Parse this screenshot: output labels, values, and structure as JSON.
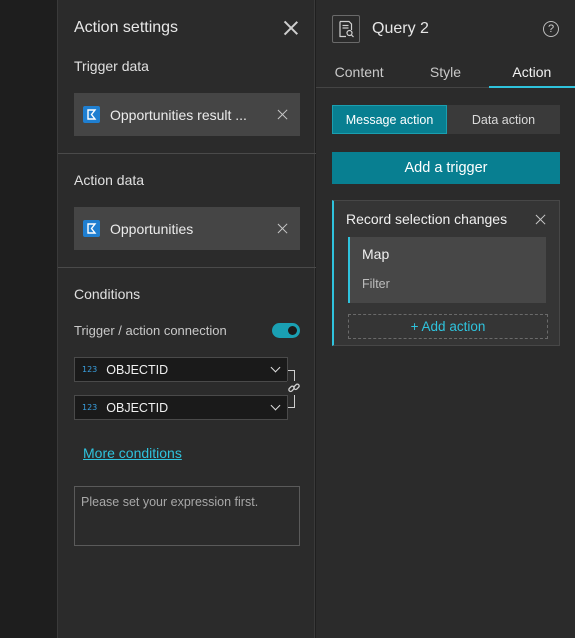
{
  "action_settings": {
    "title": "Action settings",
    "trigger_data_label": "Trigger data",
    "trigger_data_value": "Opportunities result ...",
    "action_data_label": "Action data",
    "action_data_value": "Opportunities",
    "conditions_label": "Conditions",
    "connection_label": "Trigger / action connection",
    "connection_enabled": true,
    "trigger_field": {
      "type_badge": "123",
      "value": "OBJECTID"
    },
    "action_field": {
      "type_badge": "123",
      "value": "OBJECTID"
    },
    "more_conditions": "More conditions",
    "expression_placeholder": "Please set your expression first."
  },
  "query_panel": {
    "title": "Query 2",
    "help": "?",
    "tabs": [
      "Content",
      "Style",
      "Action"
    ],
    "active_tab": "Action",
    "segments": [
      "Message action",
      "Data action"
    ],
    "active_segment": "Message action",
    "add_trigger": "Add a trigger",
    "trigger": {
      "title": "Record selection changes",
      "action_name": "Map",
      "action_sub": "Filter",
      "add_action": "+ Add action"
    }
  },
  "colors": {
    "accent": "#2fc3dd",
    "primary_button": "#087f91",
    "panel_bg": "#2b2b2b",
    "datasource_icon": "#1f7fd1"
  }
}
